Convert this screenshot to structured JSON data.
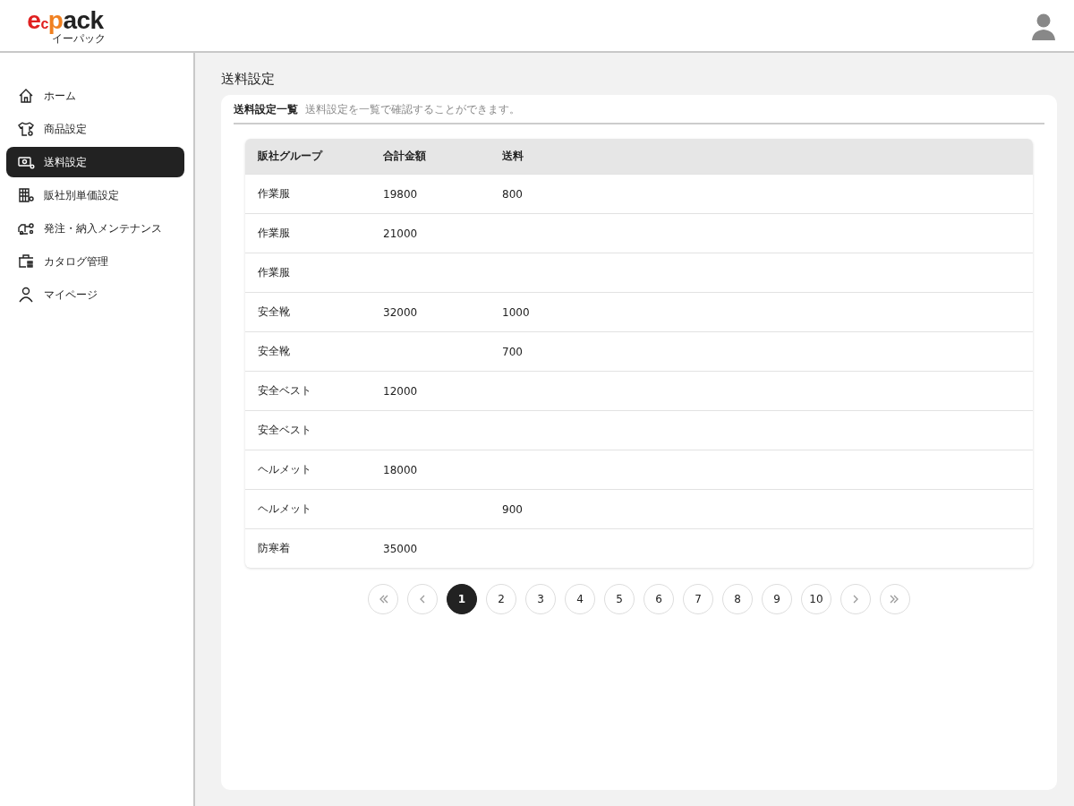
{
  "header": {
    "logo": {
      "mark": "e",
      "mark_small": "c",
      "accent": "p",
      "word": "ack",
      "sub": "イーパック"
    }
  },
  "sidebar": {
    "items": [
      {
        "label": "ホーム",
        "selected": false
      },
      {
        "label": "商品設定",
        "selected": false
      },
      {
        "label": "送料設定",
        "selected": true
      },
      {
        "label": "販社別単価設定",
        "selected": false
      },
      {
        "label": "発注・納入メンテナンス",
        "selected": false
      },
      {
        "label": "カタログ管理",
        "selected": false
      },
      {
        "label": "マイページ",
        "selected": false
      }
    ]
  },
  "page_title": "送料設定",
  "card": {
    "title": "送料設定一覧",
    "description": "送料設定を一覧で確認することができます。"
  },
  "table": {
    "columns": [
      "販社グループ",
      "合計金額",
      "送料"
    ],
    "rows": [
      {
        "group": "作業服",
        "total": "19800",
        "shipping": "800"
      },
      {
        "group": "作業服",
        "total": "21000"
      },
      {
        "group": "作業服"
      },
      {
        "group": "安全靴",
        "total": "32000",
        "shipping": "1000"
      },
      {
        "group": "安全靴",
        "shipping": "700"
      },
      {
        "group": "安全ベスト",
        "total": "12000"
      },
      {
        "group": "安全ベスト"
      },
      {
        "group": "ヘルメット",
        "total": "18000"
      },
      {
        "group": "ヘルメット",
        "shipping": "900"
      },
      {
        "group": "防寒着",
        "total": "35000"
      }
    ]
  },
  "pagination": [
    {
      "kind": "first"
    },
    {
      "kind": "prev"
    },
    {
      "kind": "page",
      "label": "1",
      "selected": true
    },
    {
      "kind": "page",
      "label": "2",
      "selected": false
    },
    {
      "kind": "page",
      "label": "3",
      "selected": false
    },
    {
      "kind": "page",
      "label": "4",
      "selected": false
    },
    {
      "kind": "page",
      "label": "5",
      "selected": false
    },
    {
      "kind": "page",
      "label": "6",
      "selected": false
    },
    {
      "kind": "page",
      "label": "7",
      "selected": false
    },
    {
      "kind": "page",
      "label": "8",
      "selected": false
    },
    {
      "kind": "page",
      "label": "9",
      "selected": false
    },
    {
      "kind": "page",
      "label": "10",
      "selected": false
    },
    {
      "kind": "next"
    },
    {
      "kind": "last"
    }
  ]
}
